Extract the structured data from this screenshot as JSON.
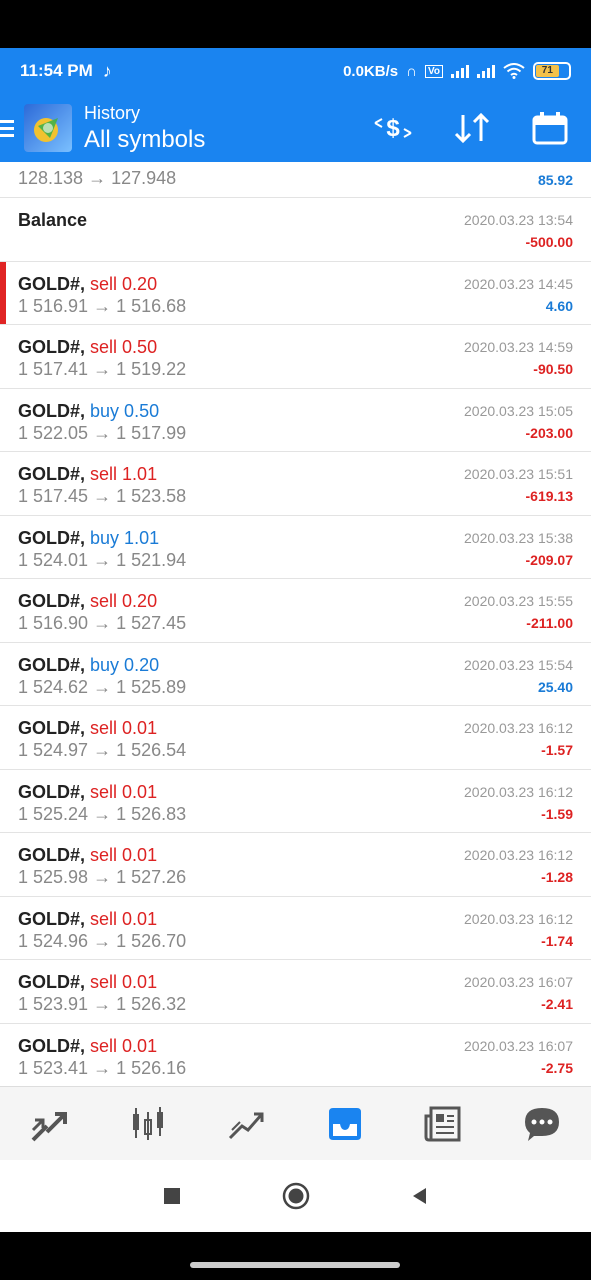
{
  "status_bar": {
    "time": "11:54 PM",
    "net_speed": "0.0KB/s",
    "battery": "71"
  },
  "app_bar": {
    "subtitle": "History",
    "title": "All symbols"
  },
  "partial_row": {
    "prices": "128.138 → 127.948",
    "profit": "85.92"
  },
  "balance_row": {
    "label": "Balance",
    "date": "2020.03.23 13:54",
    "profit": "-500.00"
  },
  "trades": [
    {
      "symbol": "GOLD#,",
      "action": "sell 0.20",
      "type": "sell",
      "prices": "1 516.91 → 1 516.68",
      "date": "2020.03.23 14:45",
      "profit": "4.60",
      "sign": "pos"
    },
    {
      "symbol": "GOLD#,",
      "action": "sell 0.50",
      "type": "sell",
      "prices": "1 517.41 → 1 519.22",
      "date": "2020.03.23 14:59",
      "profit": "-90.50",
      "sign": "neg"
    },
    {
      "symbol": "GOLD#,",
      "action": "buy 0.50",
      "type": "buy",
      "prices": "1 522.05 → 1 517.99",
      "date": "2020.03.23 15:05",
      "profit": "-203.00",
      "sign": "neg"
    },
    {
      "symbol": "GOLD#,",
      "action": "sell 1.01",
      "type": "sell",
      "prices": "1 517.45 → 1 523.58",
      "date": "2020.03.23 15:51",
      "profit": "-619.13",
      "sign": "neg"
    },
    {
      "symbol": "GOLD#,",
      "action": "buy 1.01",
      "type": "buy",
      "prices": "1 524.01 → 1 521.94",
      "date": "2020.03.23 15:38",
      "profit": "-209.07",
      "sign": "neg"
    },
    {
      "symbol": "GOLD#,",
      "action": "sell 0.20",
      "type": "sell",
      "prices": "1 516.90 → 1 527.45",
      "date": "2020.03.23 15:55",
      "profit": "-211.00",
      "sign": "neg"
    },
    {
      "symbol": "GOLD#,",
      "action": "buy 0.20",
      "type": "buy",
      "prices": "1 524.62 → 1 525.89",
      "date": "2020.03.23 15:54",
      "profit": "25.40",
      "sign": "pos"
    },
    {
      "symbol": "GOLD#,",
      "action": "sell 0.01",
      "type": "sell",
      "prices": "1 524.97 → 1 526.54",
      "date": "2020.03.23 16:12",
      "profit": "-1.57",
      "sign": "neg"
    },
    {
      "symbol": "GOLD#,",
      "action": "sell 0.01",
      "type": "sell",
      "prices": "1 525.24 → 1 526.83",
      "date": "2020.03.23 16:12",
      "profit": "-1.59",
      "sign": "neg"
    },
    {
      "symbol": "GOLD#,",
      "action": "sell 0.01",
      "type": "sell",
      "prices": "1 525.98 → 1 527.26",
      "date": "2020.03.23 16:12",
      "profit": "-1.28",
      "sign": "neg"
    },
    {
      "symbol": "GOLD#,",
      "action": "sell 0.01",
      "type": "sell",
      "prices": "1 524.96 → 1 526.70",
      "date": "2020.03.23 16:12",
      "profit": "-1.74",
      "sign": "neg"
    },
    {
      "symbol": "GOLD#,",
      "action": "sell 0.01",
      "type": "sell",
      "prices": "1 523.91 → 1 526.32",
      "date": "2020.03.23 16:07",
      "profit": "-2.41",
      "sign": "neg"
    },
    {
      "symbol": "GOLD#,",
      "action": "sell 0.01",
      "type": "sell",
      "prices": "1 523.41 → 1 526.16",
      "date": "2020.03.23 16:07",
      "profit": "-2.75",
      "sign": "neg"
    }
  ],
  "bottom_nav": [
    "quotes-icon",
    "chart-icon",
    "trade-icon",
    "history-icon",
    "news-icon",
    "messages-icon"
  ],
  "accent_color": "#1a84f0",
  "sell_color": "#d22222",
  "buy_color": "#1a7bd6"
}
